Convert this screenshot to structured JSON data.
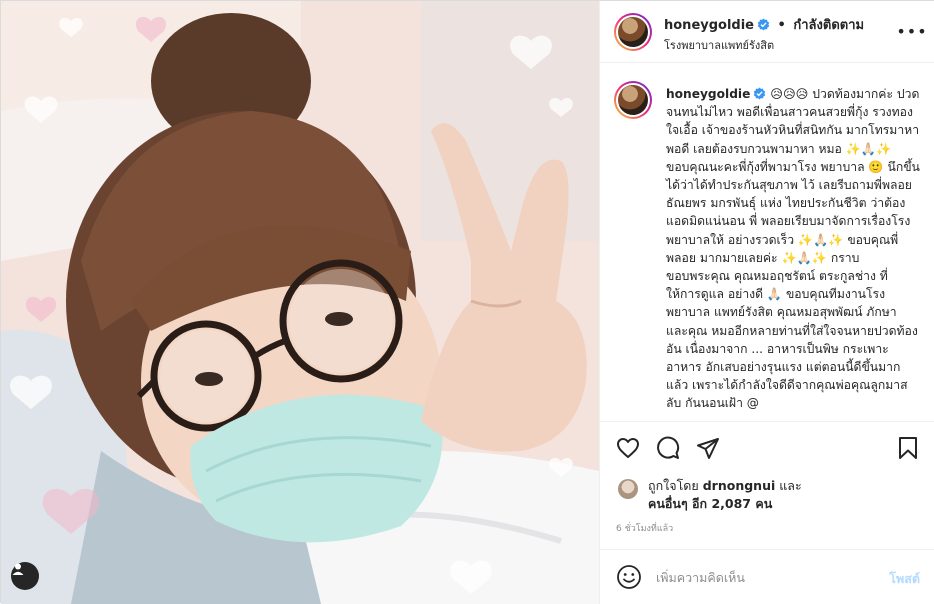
{
  "header": {
    "username": "honeygoldie",
    "dot": "•",
    "follow_label": "กำลังติดตาม",
    "location": "โรงพยาบาลแพทย์รังสิต",
    "more_label": "•••"
  },
  "caption": {
    "username": "honeygoldie",
    "text": "😥😥😥 ปวดท้องมากค่ะ ปวดจนทนไม่ไหว พอดีเพื่อนสาวคนสวยพี่กุ้ง รวงทอง ใจเอื้อ เจ้าของร้านหัวหินที่สนิทกัน มากโทรมาหาพอดี เลยต้องรบกวนพามาหา หมอ ✨🙏🏻✨ ขอบคุณนะคะพี่กุ้งที่พามาโรง พยาบาล 🙂 นึกขึ้นได้ว่าได้ทำประกันสุขภาพ ไว้ เลยรีบถามพี่พลอย ธัณยพร มกรพันธุ์ แห่ง ไทยประกันชีวิต ว่าต้องแอดมิดแน่นอน พี่ พลอยเรียบมาจัดการเรื่องโรงพยาบาลให้ อย่างรวดเร็ว ✨🙏🏻✨ ขอบคุณพี่พลอย มากมายเลยค่ะ ✨🙏🏻✨ กราบขอบพระคุณ คุณหมอฤชรัตน์ ตระกูลช่าง ที่ให้การดูแล อย่างดี 🙏🏻 ขอบคุณทีมงานโรงพยาบาล แพทย์รังสิต คุณหมอสุพพัฒน์ ภักษา และคุณ หมออีกหลายท่านที่ใส่ใจจนหายปวดท้องอัน เนื่องมาจาก ... อาหารเป็นพิษ กระเพาะอาหาร อักเสบอย่างรุนแรง แต่ตอนนี้ดีขึ้นมากแล้ว เพราะได้กำลังใจดีดีจากคุณพ่อคุณลูกมาสลับ กันนอนเฝ้า @"
  },
  "likes": {
    "prefix": "ถูกใจโดย",
    "first_user": "drnongnui",
    "and": "และ",
    "others_label": "คนอื่นๆ อีก 2,087 คน"
  },
  "time_ago": "6 ชั่วโมงที่แล้ว",
  "comment": {
    "placeholder": "เพิ่มความคิดเห็น",
    "post_label": "โพสต์"
  },
  "icons": {
    "verified": "verified-badge-icon",
    "like": "heart-icon",
    "comment": "comment-bubble-icon",
    "share": "paper-plane-icon",
    "save": "bookmark-icon",
    "emoji": "smiley-icon",
    "user_tag": "user-tag-icon"
  },
  "colors": {
    "verified_blue": "#3897f0",
    "post_button_disabled": "#b3dbff",
    "muted_text": "#8e8e8e",
    "border": "#dbdbdb"
  }
}
